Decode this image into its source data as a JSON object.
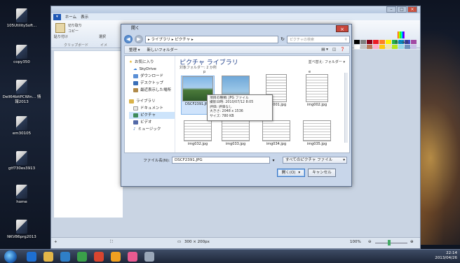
{
  "desktop": {
    "icons": [
      {
        "label": "105UtilitySoft..."
      },
      {
        "label": "copy350"
      },
      {
        "label": "Dell64bitPCWin... 情報2013"
      },
      {
        "label": "em30105"
      },
      {
        "label": "gtf730es3913"
      },
      {
        "label": "home"
      },
      {
        "label": "NKV86prg2013"
      }
    ]
  },
  "paint": {
    "tabs": [
      "ホーム",
      "表示"
    ],
    "ribbon": {
      "paste": "貼り付け",
      "cut": "切り取り",
      "copy": "コピー",
      "select": "選択",
      "clipboard_group": "クリップボード",
      "image_group": "イメ",
      "edit_colors": "色の編集"
    },
    "status": {
      "canvas_size": "300 × 200px",
      "zoom": "100%"
    },
    "palette_colors": [
      "#000000",
      "#7f7f7f",
      "#880015",
      "#ed1c24",
      "#ff7f27",
      "#fff200",
      "#22b14c",
      "#00a2e8",
      "#3f48cc",
      "#a349a4",
      "#ffffff",
      "#c3c3c3",
      "#b97a57",
      "#ffaec9",
      "#ffc90e",
      "#efe4b0",
      "#b5e61d",
      "#99d9ea",
      "#7092be",
      "#c8bfe7"
    ]
  },
  "dialog": {
    "title": "開く",
    "address": "▸ ライブラリ ▸ ピクチャ ▸",
    "search_placeholder": "ピクチャの検索",
    "toolbar": {
      "organize": "整理 ▾",
      "new_folder": "新しいフォルダー"
    },
    "nav": {
      "favorites": "お気に入り",
      "skydrive": "SkyDrive",
      "downloads": "ダウンロード",
      "desktop": "デスクトップ",
      "recent": "最近表示した場所",
      "libraries": "ライブラリ",
      "documents": "ドキュメント",
      "pictures": "ピクチャ",
      "videos": "ビデオ",
      "music": "ミュージック"
    },
    "library_title": "ピクチャ ライブラリ",
    "library_sub": "対象フォルダー: 2 か所",
    "arrange": "並べ替え: フォルダー ▾",
    "group_p": "p",
    "group_e": "e",
    "files": [
      {
        "name": "DSCF2391.JPG"
      },
      {
        "name": ""
      },
      {
        "name": "img001.jpg"
      },
      {
        "name": "img002.jpg"
      },
      {
        "name": "img032.jpg"
      },
      {
        "name": "img033.jpg"
      },
      {
        "name": "img034.jpg"
      },
      {
        "name": "img035.jpg"
      }
    ],
    "tooltip": {
      "type": "項目の種類: JPG ファイル",
      "date": "撮影日時: 2010/07/12 8:05",
      "rating": "評価: 評価なし",
      "dimensions": "大きさ: 2048 x 1536",
      "size": "サイズ: 780 KB"
    },
    "filename_label": "ファイル名(N):",
    "filename_value": "DSCF2391.JPG",
    "filetype": "すべてのピクチャ ファイル",
    "open_button": "開く(O)",
    "cancel_button": "キャンセル"
  },
  "taskbar": {
    "time": "22:14",
    "date": "2013/04/26"
  }
}
